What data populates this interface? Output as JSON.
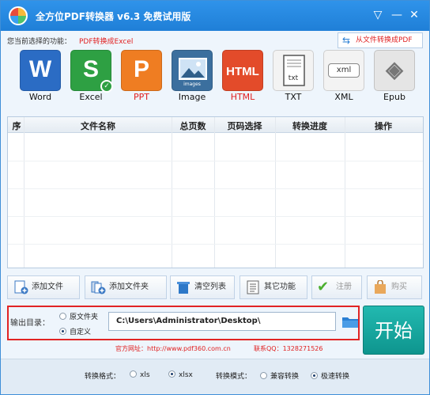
{
  "window": {
    "title": "全方位PDF转换器 v6.3 免费试用版"
  },
  "titlebar": {
    "menu_glyph": "▽",
    "minimize_glyph": "—",
    "close_glyph": "✕"
  },
  "func": {
    "label": "您当前选择的功能：",
    "value": "PDF转换成Excel",
    "from_file_label": "从文件转换成PDF"
  },
  "formats": [
    {
      "label": "Word",
      "glyph": "W",
      "color": "#2b6cc4"
    },
    {
      "label": "Excel",
      "glyph": "S",
      "color": "#2ea043"
    },
    {
      "label": "PPT",
      "glyph": "P",
      "color": "#ef7d22"
    },
    {
      "label": "Image",
      "glyph": "images",
      "color": "#3b6f9e"
    },
    {
      "label": "HTML",
      "glyph": "HTML",
      "color": "#e34b2a"
    },
    {
      "label": "TXT",
      "glyph": "txt",
      "color": "#f3f3f3"
    },
    {
      "label": "XML",
      "glyph": "xml",
      "color": "#f3f3f3"
    },
    {
      "label": "Epub",
      "glyph": "◈",
      "color": "#e5e5e5"
    }
  ],
  "table": {
    "columns": [
      "序",
      "文件名称",
      "总页数",
      "页码选择",
      "转换进度",
      "操作"
    ]
  },
  "actions": {
    "add_file": "添加文件",
    "add_folder": "添加文件夹",
    "clear_list": "清空列表",
    "other": "其它功能",
    "register": "注册",
    "buy": "购买"
  },
  "output": {
    "label": "输出目录：",
    "option_original": "原文件夹",
    "option_custom": "自定义",
    "path": "C:\\Users\\Administrator\\Desktop\\"
  },
  "start_label": "开始",
  "footer": {
    "site": "官方网址：http://www.pdf360.com.cn",
    "qq": "联系QQ：1328271526"
  },
  "bottom": {
    "format_label": "转换格式：",
    "xls": "xls",
    "xlsx": "xlsx",
    "mode_label": "转换模式：",
    "compat": "兼容转换",
    "fast": "极速转换"
  }
}
